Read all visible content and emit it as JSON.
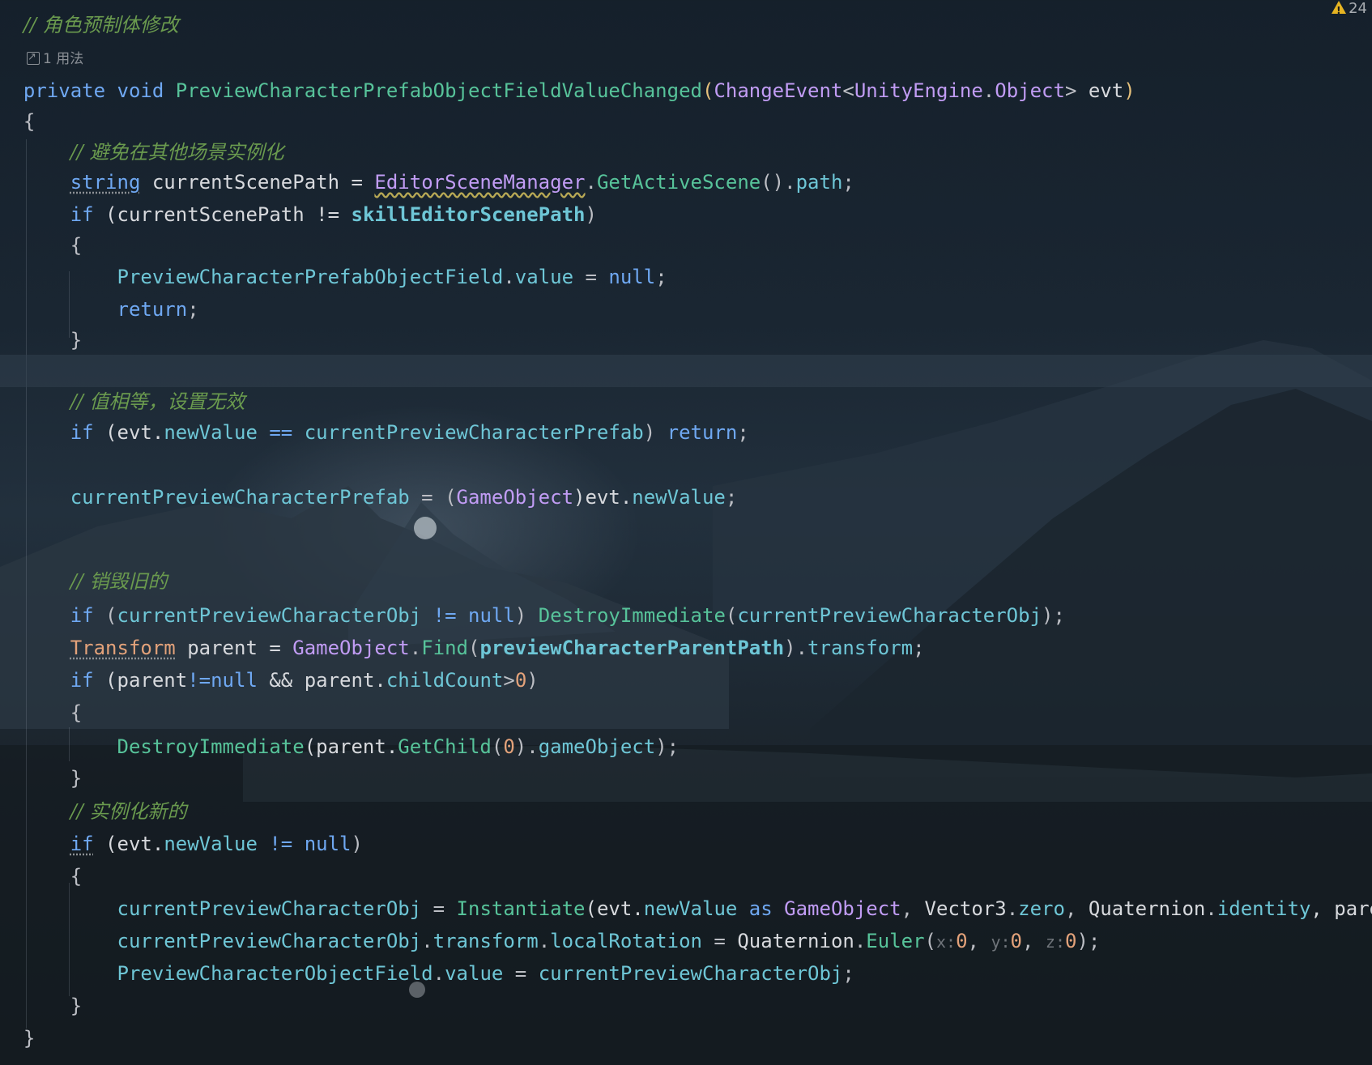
{
  "warning": {
    "icon": "warning-icon",
    "count": "24"
  },
  "usage_hint": {
    "icon": "usage-link-icon",
    "label": "1 用法"
  },
  "code": {
    "l01": {
      "c": "// 角色预制体修改"
    },
    "l03": {
      "t1": "private",
      "t2": "void",
      "t3": "PreviewCharacterPrefabObjectFieldValueChanged",
      "t4": "(",
      "t5": "ChangeEvent",
      "t6": "<",
      "t7": "UnityEngine",
      "t8": ".",
      "t9": "Object",
      "t10": "> ",
      "t11": "evt",
      "t12": ")"
    },
    "l04": {
      "t1": "{"
    },
    "l05": {
      "c": "// 避免在其他场景实例化"
    },
    "l06": {
      "t1": "string",
      "t2": " currentScenePath = ",
      "t3": "EditorSceneManager",
      "t4": ".",
      "t5": "GetActiveScene",
      "t6": "().",
      "t7": "path",
      "t8": ";"
    },
    "l07": {
      "t1": "if",
      "t2": " (currentScenePath != ",
      "t3": "skillEditorScenePath",
      "t4": ")"
    },
    "l08": {
      "t1": "{"
    },
    "l09": {
      "t1": "PreviewCharacterPrefabObjectField",
      "t2": ".",
      "t3": "value",
      "t4": " = ",
      "t5": "null",
      "t6": ";"
    },
    "l10": {
      "t1": "return",
      "t2": ";"
    },
    "l11": {
      "t1": "}"
    },
    "l13": {
      "c": "// 值相等，设置无效"
    },
    "l14": {
      "t1": "if",
      "t2": " (evt.",
      "t3": "newValue",
      "t4": " == ",
      "t5": "currentPreviewCharacterPrefab",
      "t6": ") ",
      "t7": "return",
      "t8": ";"
    },
    "l16": {
      "t1": "currentPreviewCharacterPrefab",
      "t2": " = (",
      "t3": "GameObject",
      "t4": ")evt.",
      "t5": "newValue",
      "t6": ";"
    },
    "l18": {
      "c": "// 销毁旧的"
    },
    "l19": {
      "t1": "if",
      "t2": " (",
      "t3": "currentPreviewCharacterObj",
      "t4": " != ",
      "t5": "null",
      "t6": ") ",
      "t7": "DestroyImmediate",
      "t8": "(",
      "t9": "currentPreviewCharacterObj",
      "t10": ");"
    },
    "l20": {
      "t1": "Transform",
      "t2": " parent = ",
      "t3": "GameObject",
      "t4": ".",
      "t5": "Find",
      "t6": "(",
      "t7": "previewCharacterParentPath",
      "t8": ").",
      "t9": "transform",
      "t10": ";"
    },
    "l21": {
      "t1": "if",
      "t2": " (parent",
      "t3": "!=",
      "t4": "null",
      "t5": " && parent.",
      "t6": "childCount",
      "t7": ">",
      "t8": "0",
      "t9": ")"
    },
    "l22": {
      "t1": "{"
    },
    "l23": {
      "t1": "DestroyImmediate",
      "t2": "(parent.",
      "t3": "GetChild",
      "t4": "(",
      "t5": "0",
      "t6": ").",
      "t7": "gameObject",
      "t8": ");"
    },
    "l24": {
      "t1": "}"
    },
    "l25": {
      "c": "// 实例化新的"
    },
    "l26": {
      "t1": "if",
      "t2": " (evt.",
      "t3": "newValue",
      "t4": " != ",
      "t5": "null",
      "t6": ")"
    },
    "l27": {
      "t1": "{"
    },
    "l28": {
      "t1": "currentPreviewCharacterObj",
      "t2": " = ",
      "t3": "Instantiate",
      "t4": "(evt.",
      "t5": "newValue",
      "t6": " as ",
      "t7": "GameObject",
      "t8": ", ",
      "t9": "Vector3",
      "t10": ".",
      "t11": "zero",
      "t12": ", ",
      "t13": "Quaternion",
      "t14": ".",
      "t15": "identity",
      "t16": ", parent)"
    },
    "l29": {
      "t1": "currentPreviewCharacterObj",
      "t2": ".",
      "t3": "transform",
      "t4": ".",
      "t5": "localRotation",
      "t6": " = ",
      "t7": "Quaternion",
      "t8": ".",
      "t9": "Euler",
      "t10": "(",
      "h1": "x:",
      "t11": "0",
      "t12": ", ",
      "h2": "y:",
      "t13": "0",
      "t14": ", ",
      "h3": "z:",
      "t15": "0",
      "t16": ");"
    },
    "l30": {
      "t1": "PreviewCharacterObjectField",
      "t2": ".",
      "t3": "value",
      "t4": " = ",
      "t5": "currentPreviewCharacterObj",
      "t6": ";"
    },
    "l31": {
      "t1": "}"
    },
    "l32": {
      "t1": "}"
    }
  },
  "colors": {
    "keyword": "#6fa8f2",
    "type": "#c19cf4",
    "method": "#57c39a",
    "field": "#6ec6d6",
    "number": "#e3a27a",
    "comment": "#6a9a4e",
    "text": "#bcbec4"
  }
}
